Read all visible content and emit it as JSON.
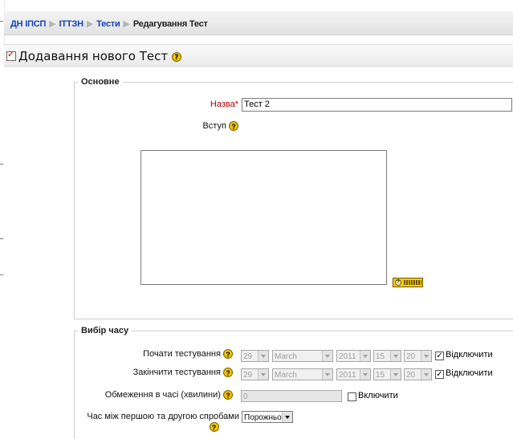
{
  "breadcrumb": {
    "items": [
      "ДН ІПСП",
      "ІТТЗН",
      "Тести"
    ],
    "current": "Редагування Тест"
  },
  "page": {
    "title": "Додавання нового Тест",
    "help_glyph": "?"
  },
  "general": {
    "legend": "Основне",
    "name_label": "Назва",
    "name_required_mark": "*",
    "name_value": "Тест 2",
    "intro_label": "Вступ",
    "intro_value": ""
  },
  "timing": {
    "legend": "Вибір часу",
    "open_label": "Почати тестування",
    "close_label": "Закінчити тестування",
    "limit_label": "Обмеження в часі (хвилини)",
    "delay_label": "Час між першою та другою спробами",
    "open": {
      "day": "29",
      "month": "March",
      "year": "2011",
      "hour": "15",
      "minute": "20",
      "disable_label": "Відключити",
      "disable_checked": true
    },
    "close": {
      "day": "29",
      "month": "March",
      "year": "2011",
      "hour": "15",
      "minute": "20",
      "disable_label": "Відключити",
      "disable_checked": true
    },
    "limit_value": "0",
    "limit_enable_label": "Включити",
    "limit_enable_checked": false,
    "delay_value": "Порожньо"
  }
}
